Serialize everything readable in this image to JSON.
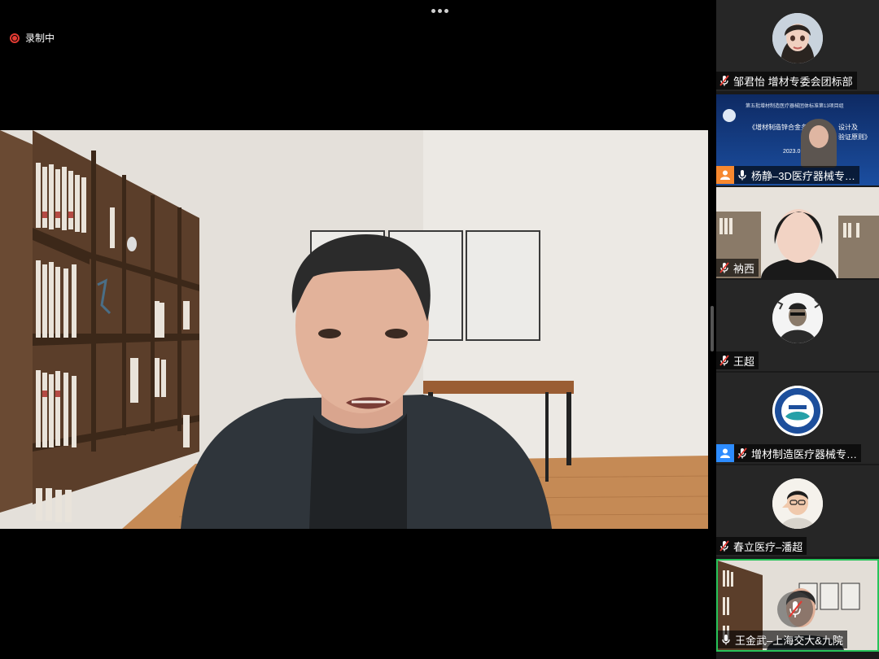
{
  "recording": {
    "label": "录制中"
  },
  "gallery": {
    "participants": [
      {
        "name": "邹君怡 增材专委会团标部",
        "mic": "muted",
        "badge": "none"
      },
      {
        "name": "杨静–3D医疗器械专…",
        "mic": "on",
        "badge": "orange",
        "slide": {
          "line1": "第五批增材制造医疗器械团体标准第13项目组",
          "line2": "《增材制造锌合金多",
          "line2b": "设计及",
          "line3": "验证原则》",
          "line4": "2023.0"
        }
      },
      {
        "name": "衲西",
        "mic": "muted",
        "badge": "none"
      },
      {
        "name": "王超",
        "mic": "muted",
        "badge": "none"
      },
      {
        "name": "增材制造医疗器械专…",
        "mic": "muted",
        "badge": "blue"
      },
      {
        "name": "春立医疗–潘超",
        "mic": "muted",
        "badge": "none"
      },
      {
        "name": "王金武–上海交大&九院",
        "mic": "on",
        "badge": "none",
        "active": true
      }
    ]
  },
  "colors": {
    "active_border": "#27c35a",
    "record_red": "#e23b33",
    "host_orange": "#f7882f",
    "host_blue": "#2d8cff"
  }
}
